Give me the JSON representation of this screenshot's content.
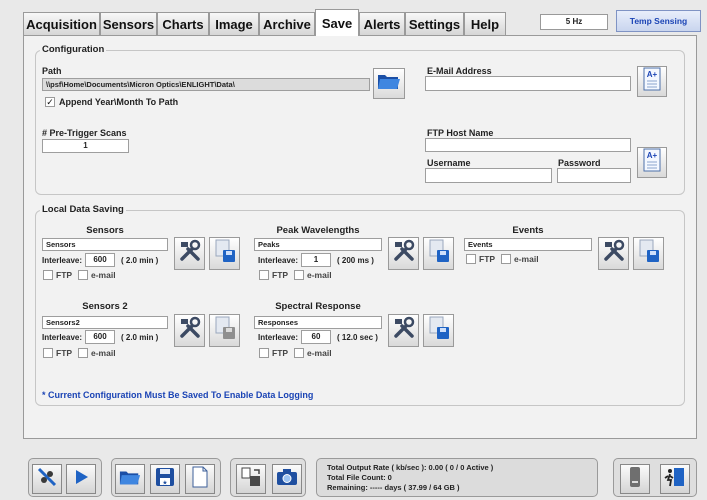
{
  "tabs": [
    {
      "label": "Acquisition"
    },
    {
      "label": "Sensors"
    },
    {
      "label": "Charts"
    },
    {
      "label": "Image"
    },
    {
      "label": "Archive"
    },
    {
      "label": "Save"
    },
    {
      "label": "Alerts"
    },
    {
      "label": "Settings"
    },
    {
      "label": "Help"
    }
  ],
  "active_tab": "Save",
  "header": {
    "rate": "5 Hz",
    "mode": "Temp Sensing"
  },
  "configuration": {
    "title": "Configuration",
    "path_label": "Path",
    "path_value": "\\\\psf\\Home\\Documents\\Micron Optics\\ENLIGHT\\Data\\",
    "append_checked": true,
    "append_label": "Append Year\\Month To Path",
    "pretrigger_label": "# Pre-Trigger Scans",
    "pretrigger_value": "1",
    "email_label": "E-Mail Address",
    "email_value": "",
    "ftp_host_label": "FTP Host Name",
    "ftp_host_value": "",
    "username_label": "Username",
    "username_value": "",
    "password_label": "Password",
    "password_value": ""
  },
  "local_saving": {
    "title": "Local Data Saving",
    "interleave_label": "Interleave:",
    "ftp_label": "FTP",
    "email_label": "e-mail",
    "sensors": {
      "title": "Sensors",
      "name": "Sensors",
      "interleave": "600",
      "duration": "( 2.0 min )"
    },
    "peaks": {
      "title": "Peak Wavelengths",
      "name": "Peaks",
      "interleave": "1",
      "duration": "( 200 ms )"
    },
    "events": {
      "title": "Events",
      "name": "Events"
    },
    "sensors2": {
      "title": "Sensors 2",
      "name": "Sensors2",
      "interleave": "600",
      "duration": "( 2.0 min )"
    },
    "spectral": {
      "title": "Spectral Response",
      "name": "Responses",
      "interleave": "60",
      "duration": "( 12.0 sec )"
    },
    "note": "* Current Configuration Must Be Saved To Enable Data Logging"
  },
  "status": {
    "line1": "Total Output Rate ( kb/sec ): 0.00 ( 0 / 0 Active )",
    "line2": "Total File Count: 0",
    "line3": "Remaining: ----- days ( 37.99 / 64 GB )"
  },
  "colors": {
    "accent_blue": "#1f63c4",
    "note_blue": "#1b44b5",
    "panel": "#f2f2f2"
  }
}
